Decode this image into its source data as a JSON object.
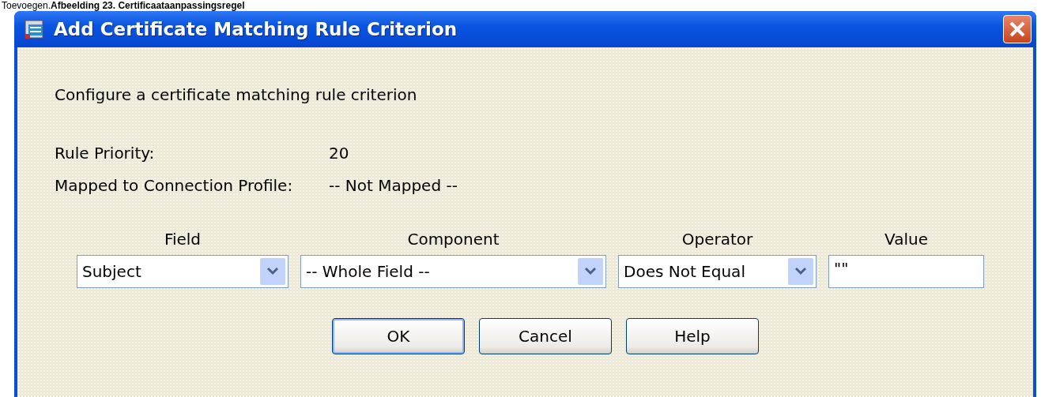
{
  "caption": "Toevoegen.**Afbeelding 23. Certificaataanpassingsregel**",
  "window": {
    "title": "Add Certificate Matching Rule Criterion"
  },
  "description": "Configure a certificate matching rule criterion",
  "info": [
    {
      "label": "Rule Priority:",
      "value": "20"
    },
    {
      "label": "Mapped to Connection Profile:",
      "value": "-- Not Mapped --"
    }
  ],
  "criterion": [
    {
      "heading": "Field",
      "kind": "dropdown",
      "value": "Subject"
    },
    {
      "heading": "Component",
      "kind": "dropdown",
      "value": "-- Whole Field --"
    },
    {
      "heading": "Operator",
      "kind": "dropdown",
      "value": "Does Not Equal"
    },
    {
      "heading": "Value",
      "kind": "text",
      "value": "\"\""
    }
  ],
  "buttons": [
    {
      "label": "OK",
      "default": true
    },
    {
      "label": "Cancel",
      "default": false
    },
    {
      "label": "Help",
      "default": false
    }
  ]
}
